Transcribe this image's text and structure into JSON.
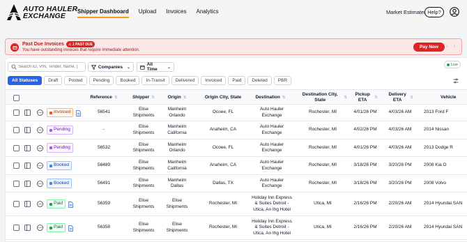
{
  "app": {
    "logo_line1": "AUTO HAULER",
    "logo_line2": "EXCHANGE"
  },
  "nav": {
    "items": [
      "Shipper Dashboard",
      "Upload",
      "Invoices",
      "Analytics"
    ],
    "market": "Market Estimates",
    "help": "Help?"
  },
  "banner": {
    "title": "Past Due Invoices",
    "badge": "1 PAST DUE",
    "subtitle": "You have outstanding invoices that require immediate attention.",
    "pay_button": "Pay Now",
    "prev": "‹",
    "next": "›"
  },
  "toolbar": {
    "search_placeholder": "Search ID, VIN, Tender, Name, (",
    "companies": "Companies",
    "time": "All Time",
    "live": "Live"
  },
  "tabs": [
    "All Statuses",
    "Draft",
    "Posted",
    "Pending",
    "Booked",
    "In-Transit",
    "Delivered",
    "Invoiced",
    "Paid",
    "Deleted",
    "PBR"
  ],
  "columns": {
    "reference": "Reference",
    "shipper": "Shipper",
    "origin": "Origin",
    "origin_city": "Origin City, State",
    "destination": "Destination",
    "dest_city": "Destination City, State",
    "pickup": "Pickup ETA",
    "delivery": "Delivery ETA",
    "vehicle": "Vehicle"
  },
  "rows": [
    {
      "status": "Invoiced",
      "status_key": "invoiced",
      "doc": true,
      "reference": "56541",
      "shipper": "Elise Shipments",
      "origin": "Manheim Orlando",
      "origin_city": "Ocoee, FL",
      "destination": "Auto Hauler Exchange",
      "dest_city": "Rochester, MI",
      "pickup": "4/01/26 PM",
      "delivery": "4/03/26 AM",
      "vehicle": "2013 Ford F"
    },
    {
      "status": "Pending",
      "status_key": "pending",
      "doc": false,
      "reference": "-",
      "shipper": "Elise Shipments",
      "origin": "Manheim California",
      "origin_city": "Anaheim, CA",
      "destination": "Auto Hauler Exchange",
      "dest_city": "Rochester, MI",
      "pickup": "4/02/26 PM",
      "delivery": "4/03/26 AM",
      "vehicle": "2014 Nissan"
    },
    {
      "status": "Pending",
      "status_key": "pending",
      "doc": false,
      "reference": "56532",
      "shipper": "Elise Shipments",
      "origin": "Manheim Orlando",
      "origin_city": "Ocoee, FL",
      "destination": "Auto Hauler Exchange",
      "dest_city": "Rochester, MI",
      "pickup": "4/01/26 PM",
      "delivery": "4/03/26 AM",
      "vehicle": "2013 Dodge R"
    },
    {
      "status": "Booked",
      "status_key": "booked",
      "doc": false,
      "reference": "56489",
      "shipper": "Elise Shipments",
      "origin": "Manheim California",
      "origin_city": "Anaheim, CA",
      "destination": "Auto Hauler Exchange",
      "dest_city": "Rochester, MI",
      "pickup": "3/18/26 PM",
      "delivery": "3/20/26 PM",
      "vehicle": "2008 Kia O"
    },
    {
      "status": "Booked",
      "status_key": "booked",
      "doc": false,
      "reference": "56491",
      "shipper": "Elise Shipments",
      "origin": "Manheim Dallas",
      "origin_city": "Dallas, TX",
      "destination": "Auto Hauler Exchange",
      "dest_city": "Rochester, MI",
      "pickup": "3/18/26 PM",
      "delivery": "3/20/26 PM",
      "vehicle": "2008 Volvo"
    },
    {
      "status": "Paid",
      "status_key": "paid",
      "doc": true,
      "reference": "56359",
      "shipper": "Elise Shipments",
      "origin": "Elise Shipments",
      "origin_city": "Rochester, MI",
      "destination": "Holiday Inn Express & Suites Detroit - Utica, An Ihg Hotel",
      "dest_city": "Utica, MI",
      "pickup": "2/16/26 PM",
      "delivery": "2/20/26 AM",
      "vehicle": "2014 Hyundai SAN"
    },
    {
      "status": "Paid",
      "status_key": "paid",
      "doc": true,
      "reference": "56358",
      "shipper": "Elise Shipments",
      "origin": "Elise Shipments",
      "origin_city": "Rochester, MI",
      "destination": "Holiday Inn Express & Suites Detroit - Utica, An Ihg Hotel",
      "dest_city": "Utica, MI",
      "pickup": "2/16/26 PM",
      "delivery": "2/20/26 AM",
      "vehicle": "2014 Hyundai SAN"
    }
  ]
}
